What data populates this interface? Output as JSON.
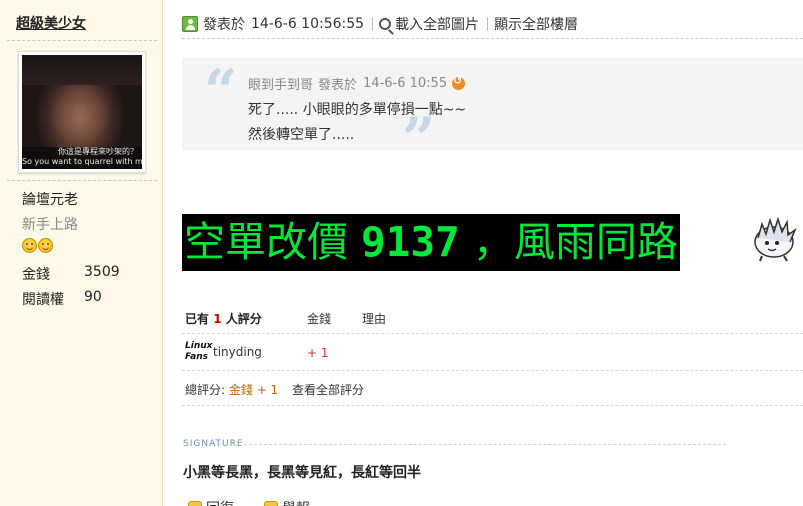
{
  "author": {
    "name": "超級美少女",
    "avatar_caption_zh": "你這是專程來吵架的？",
    "avatar_caption_en": "So you want to quarrel with me",
    "rank": "論壇元老",
    "rank_sub": "新手上路",
    "stats": [
      {
        "label": "金錢",
        "value": "3509"
      },
      {
        "label": "閱讀權",
        "value": "90"
      }
    ]
  },
  "post": {
    "posted_label": "發表於",
    "posted_time": "14-6-6 10:56:55",
    "download_label": "載入全部圖片",
    "show_floors_label": "顯示全部樓層",
    "quote": {
      "author": "眼到手到哥",
      "posted_label": "發表於",
      "time": "14-6-6 10:55",
      "line1": "死了.....   小眼眼的多單停損一點~~",
      "line2": "然後轉空單了....."
    },
    "big_text": {
      "part1": "空單改價 ",
      "number": "9137",
      "part2": " ，風雨同路"
    }
  },
  "rating": {
    "header_prefix": "已有",
    "count": "1",
    "header_suffix": "人評分",
    "col_money": "金錢",
    "col_reason": "理由",
    "rater_logo": "Linux Fans",
    "rater_name": "tinyding",
    "rater_value": "+ 1",
    "total_label": "總評分:",
    "total_amount": "金錢 + 1",
    "view_all": "查看全部評分"
  },
  "signature": {
    "label": "SIGNATURE",
    "text": "小黑等長黑，長黑等見紅，長紅等回半"
  },
  "actions": {
    "reply": "回復",
    "report": "舉報"
  }
}
